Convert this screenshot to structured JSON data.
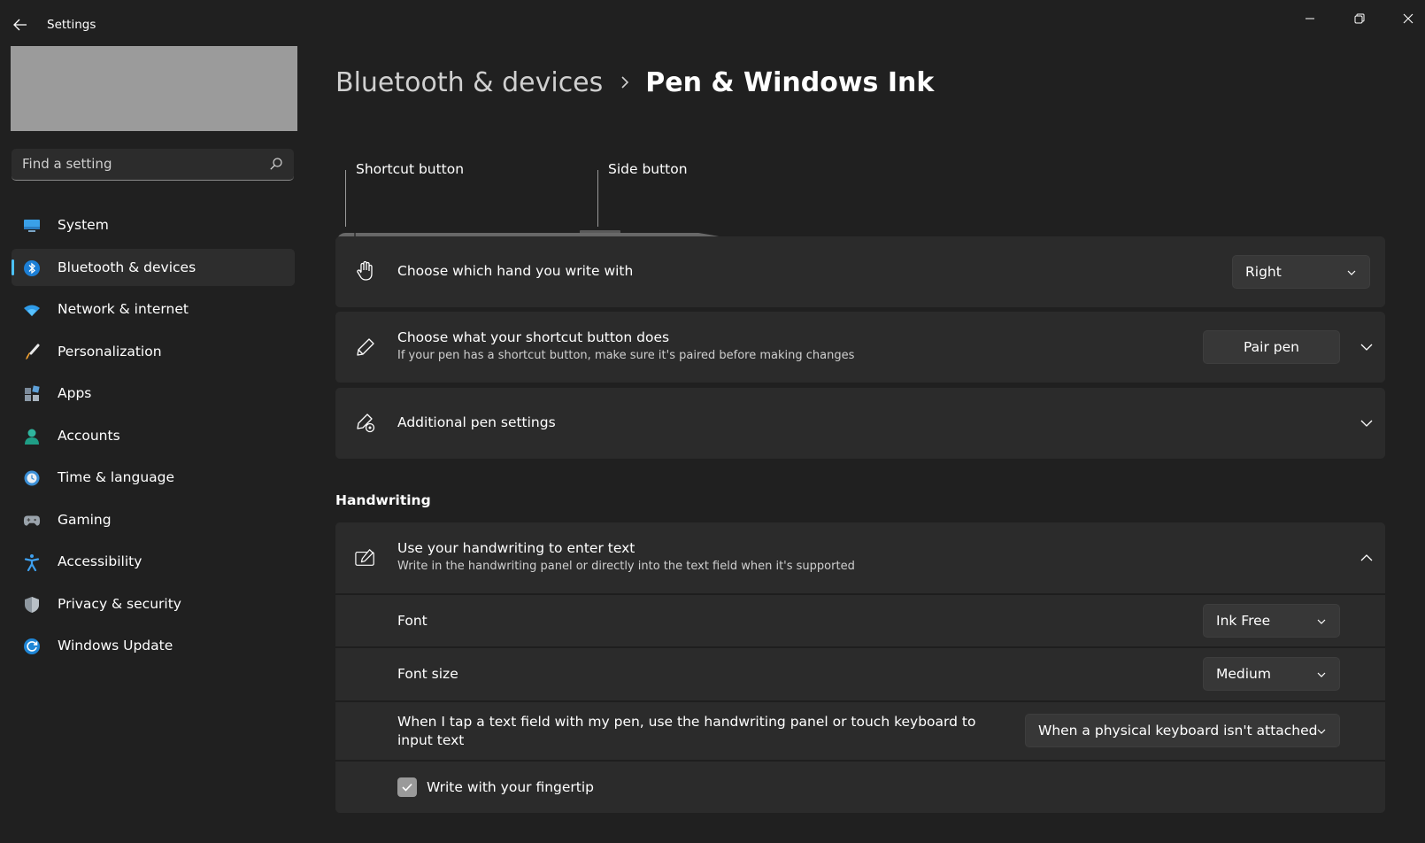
{
  "app": {
    "title": "Settings"
  },
  "search": {
    "placeholder": "Find a setting"
  },
  "sidebar": {
    "items": [
      {
        "label": "System",
        "icon": "monitor-icon"
      },
      {
        "label": "Bluetooth & devices",
        "icon": "bluetooth-icon",
        "active": true
      },
      {
        "label": "Network & internet",
        "icon": "wifi-icon"
      },
      {
        "label": "Personalization",
        "icon": "brush-icon"
      },
      {
        "label": "Apps",
        "icon": "apps-icon"
      },
      {
        "label": "Accounts",
        "icon": "person-icon"
      },
      {
        "label": "Time & language",
        "icon": "clock-globe-icon"
      },
      {
        "label": "Gaming",
        "icon": "gamepad-icon"
      },
      {
        "label": "Accessibility",
        "icon": "accessibility-icon"
      },
      {
        "label": "Privacy & security",
        "icon": "shield-icon"
      },
      {
        "label": "Windows Update",
        "icon": "update-icon"
      }
    ]
  },
  "breadcrumb": {
    "parent": "Bluetooth & devices",
    "current": "Pen & Windows Ink"
  },
  "pen_diagram": {
    "shortcut_label": "Shortcut button",
    "side_label": "Side button"
  },
  "settings": {
    "hand": {
      "title": "Choose which hand you write with",
      "value": "Right"
    },
    "shortcut": {
      "title": "Choose what your shortcut button does",
      "subtitle": "If your pen has a shortcut button, make sure it's paired before making changes",
      "button": "Pair pen"
    },
    "additional": {
      "title": "Additional pen settings"
    }
  },
  "handwriting": {
    "header": "Handwriting",
    "main": {
      "title": "Use your handwriting to enter text",
      "subtitle": "Write in the handwriting panel or directly into the text field when it's supported"
    },
    "font": {
      "label": "Font",
      "value": "Ink Free"
    },
    "font_size": {
      "label": "Font size",
      "value": "Medium"
    },
    "tap_mode": {
      "label": "When I tap a text field with my pen, use the handwriting panel or touch keyboard to input text",
      "value": "When a physical keyboard isn't attached"
    },
    "fingertip": {
      "label": "Write with your fingertip",
      "checked": true
    }
  },
  "colors": {
    "accent": "#4cc2ff",
    "background": "#202020",
    "card": "#2b2b2b"
  }
}
